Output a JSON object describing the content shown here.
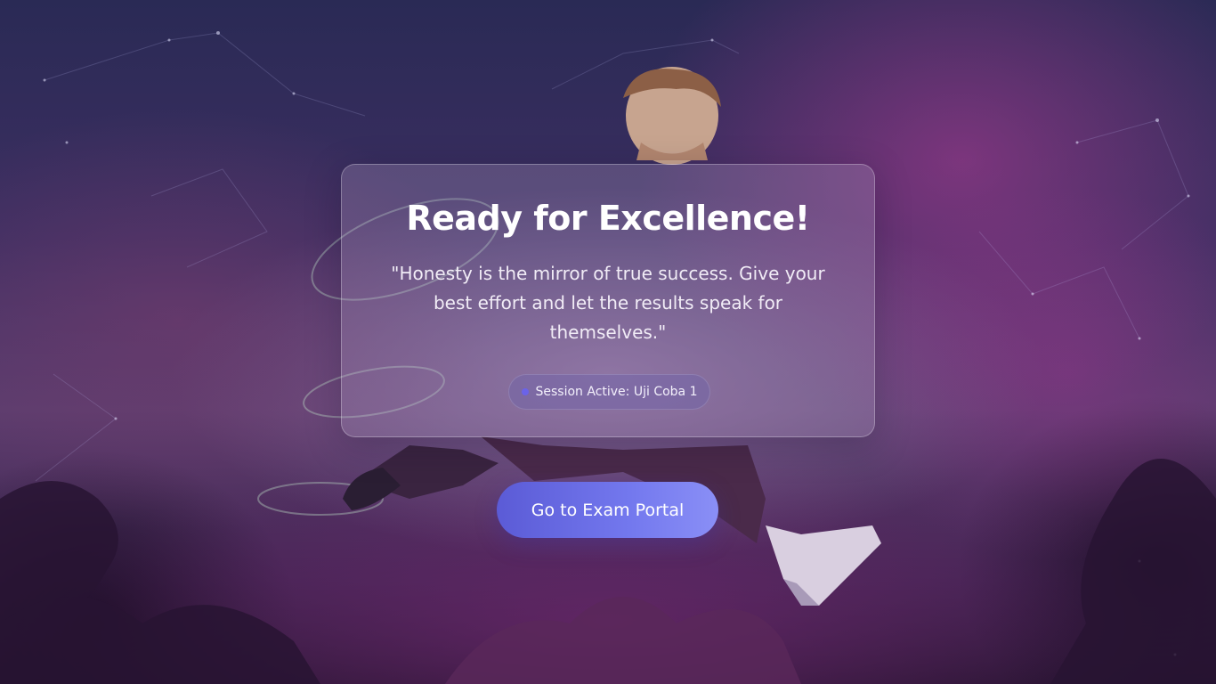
{
  "hero": {
    "title": "Ready for Excellence!",
    "quote": "\"Honesty is the mirror of true success. Give your best effort and let the results speak for themselves.\""
  },
  "session": {
    "status_text": "Session Active: Uji Coba 1",
    "status_icon": "status-dot-icon",
    "dot_color": "#6b63e8"
  },
  "actions": {
    "portal_button_label": "Go to Exam Portal",
    "button_gradient": [
      "#5b5bd6",
      "#8a8ff6"
    ]
  },
  "theme": {
    "background_tones": [
      "#2a2a55",
      "#5a3d6e",
      "#b43c96"
    ]
  }
}
